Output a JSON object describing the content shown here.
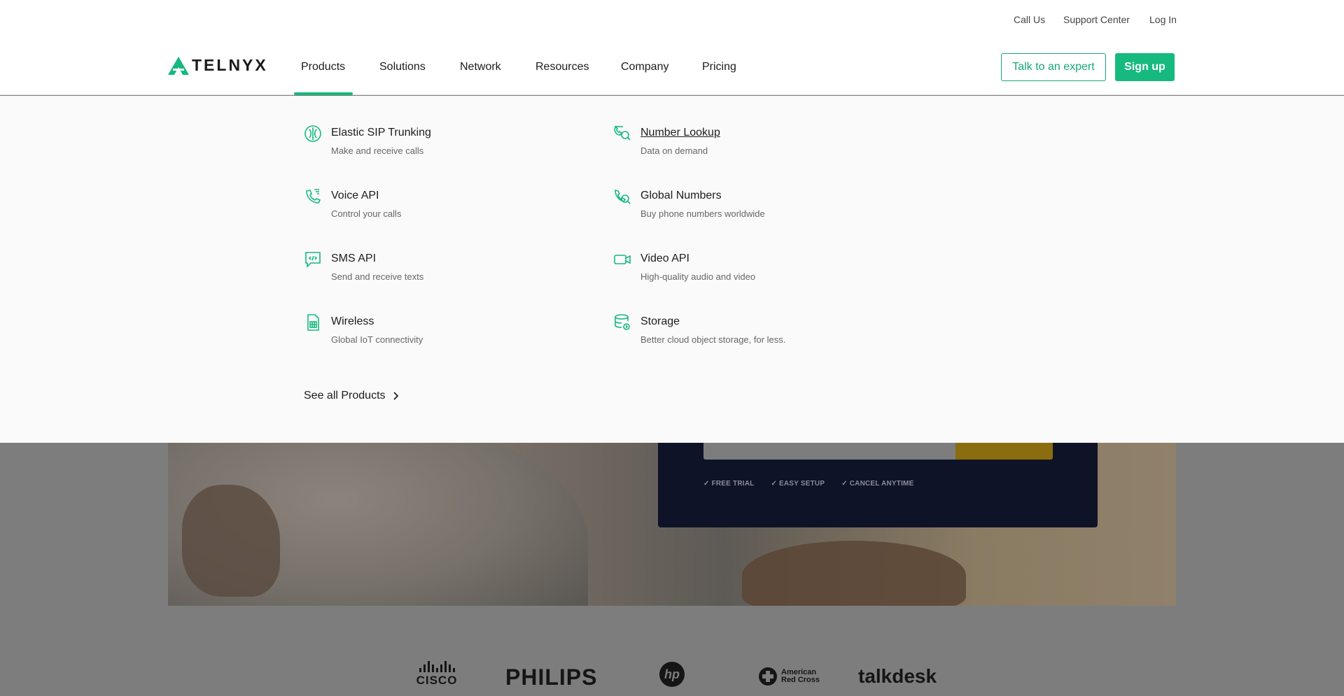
{
  "utility_bar": {
    "call_us": "Call Us",
    "support": "Support Center",
    "login": "Log In"
  },
  "brand": {
    "name": "TELNYX",
    "accent_color": "#16b97e"
  },
  "nav": {
    "items": [
      {
        "label": "Products",
        "active": true
      },
      {
        "label": "Solutions"
      },
      {
        "label": "Network"
      },
      {
        "label": "Resources"
      },
      {
        "label": "Company"
      },
      {
        "label": "Pricing"
      }
    ],
    "talk_expert": "Talk to an expert",
    "sign_up": "Sign up"
  },
  "products_menu": {
    "items": [
      {
        "title": "Elastic SIP Trunking",
        "desc": "Make and receive calls",
        "icon": "sip-trunk-icon"
      },
      {
        "title": "Number Lookup",
        "desc": "Data on demand",
        "icon": "number-lookup-icon",
        "hovered": true
      },
      {
        "title": "Voice API",
        "desc": "Control your calls",
        "icon": "phone-icon"
      },
      {
        "title": "Global Numbers",
        "desc": "Buy phone numbers worldwide",
        "icon": "global-numbers-icon"
      },
      {
        "title": "SMS API",
        "desc": "Send and receive texts",
        "icon": "chat-code-icon"
      },
      {
        "title": "Video API",
        "desc": "High-quality audio and video",
        "icon": "video-camera-icon"
      },
      {
        "title": "Wireless",
        "desc": "Global IoT connectivity",
        "icon": "sim-card-icon"
      },
      {
        "title": "Storage",
        "desc": "Better cloud object storage, for less.",
        "icon": "storage-icon"
      }
    ],
    "see_all": "See all Products"
  },
  "signup_panel": {
    "checks": [
      "FREE TRIAL",
      "EASY SETUP",
      "CANCEL ANYTIME"
    ]
  },
  "customer_logos": [
    "CISCO",
    "PHILIPS",
    "hp",
    "American Red Cross",
    "talkdesk"
  ]
}
